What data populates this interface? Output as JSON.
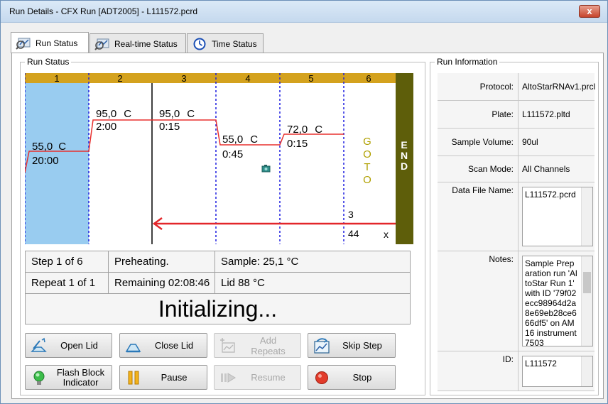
{
  "window": {
    "title": "Run Details - CFX Run [ADT2005] - L111572.pcrd",
    "close_glyph": "x"
  },
  "tabs": [
    {
      "label": "Run Status",
      "icon": "magnifier-chart-icon",
      "active": true
    },
    {
      "label": "Real-time Status",
      "icon": "magnifier-chart-icon",
      "active": false
    },
    {
      "label": "Time Status",
      "icon": "clock-icon",
      "active": false
    }
  ],
  "run_status": {
    "group_label": "Run Status",
    "protocol": {
      "steps": [
        {
          "number": "1",
          "temp": "55,0",
          "unit": "C",
          "time": "20:00",
          "level": 55.0
        },
        {
          "number": "2",
          "temp": "95,0",
          "unit": "C",
          "time": "2:00",
          "level": 95.0
        },
        {
          "number": "3",
          "temp": "95,0",
          "unit": "C",
          "time": "0:15",
          "level": 95.0
        },
        {
          "number": "4",
          "temp": "55,0",
          "unit": "C",
          "time": "0:45",
          "level": 55.0,
          "plate_read": true
        },
        {
          "number": "5",
          "temp": "72,0",
          "unit": "C",
          "time": "0:15",
          "level": 72.0
        },
        {
          "number": "6",
          "goto_letters": [
            "G",
            "O",
            "T",
            "O"
          ],
          "goto_step": "3",
          "goto_count": "44",
          "goto_x": "x"
        }
      ],
      "end_letters": [
        "E",
        "N",
        "D"
      ],
      "current_step": 1,
      "colors": {
        "current": "#99ccf0",
        "header": "#d4a21e",
        "end": "#5e5e0a",
        "line": "#e8302e",
        "cycle_arrow": "#e3262a",
        "divider": "#1f1fe0"
      }
    },
    "status": {
      "step": "Step 1 of 6",
      "state": "Preheating.",
      "sample": "Sample: 25,1 °C",
      "repeat": "Repeat 1 of 1",
      "remaining": "Remaining 02:08:46",
      "lid": "Lid 88 °C",
      "message": "Initializing..."
    },
    "buttons": {
      "open_lid": "Open Lid",
      "close_lid": "Close Lid",
      "add_repeats": "Add Repeats",
      "skip_step": "Skip Step",
      "flash_line1": "Flash Block",
      "flash_line2": "Indicator",
      "pause": "Pause",
      "resume": "Resume",
      "stop": "Stop"
    }
  },
  "run_info": {
    "group_label": "Run Information",
    "protocol_label": "Protocol:",
    "protocol_value": "AltoStarRNAv1.prcl",
    "plate_label": "Plate:",
    "plate_value": "L111572.pltd",
    "sample_volume_label": "Sample Volume:",
    "sample_volume_value": "90ul",
    "scan_mode_label": "Scan Mode:",
    "scan_mode_value": "All Channels",
    "data_file_label": "Data File Name:",
    "data_file_value": "L111572.pcrd",
    "notes_label": "Notes:",
    "notes_value": "Sample Preparation run 'AltoStar Run 1' with ID '79f02ecc98964d2a8e69eb28ce666df5' on AM16 instrument 7503",
    "id_label": "ID:",
    "id_value": "L111572"
  }
}
